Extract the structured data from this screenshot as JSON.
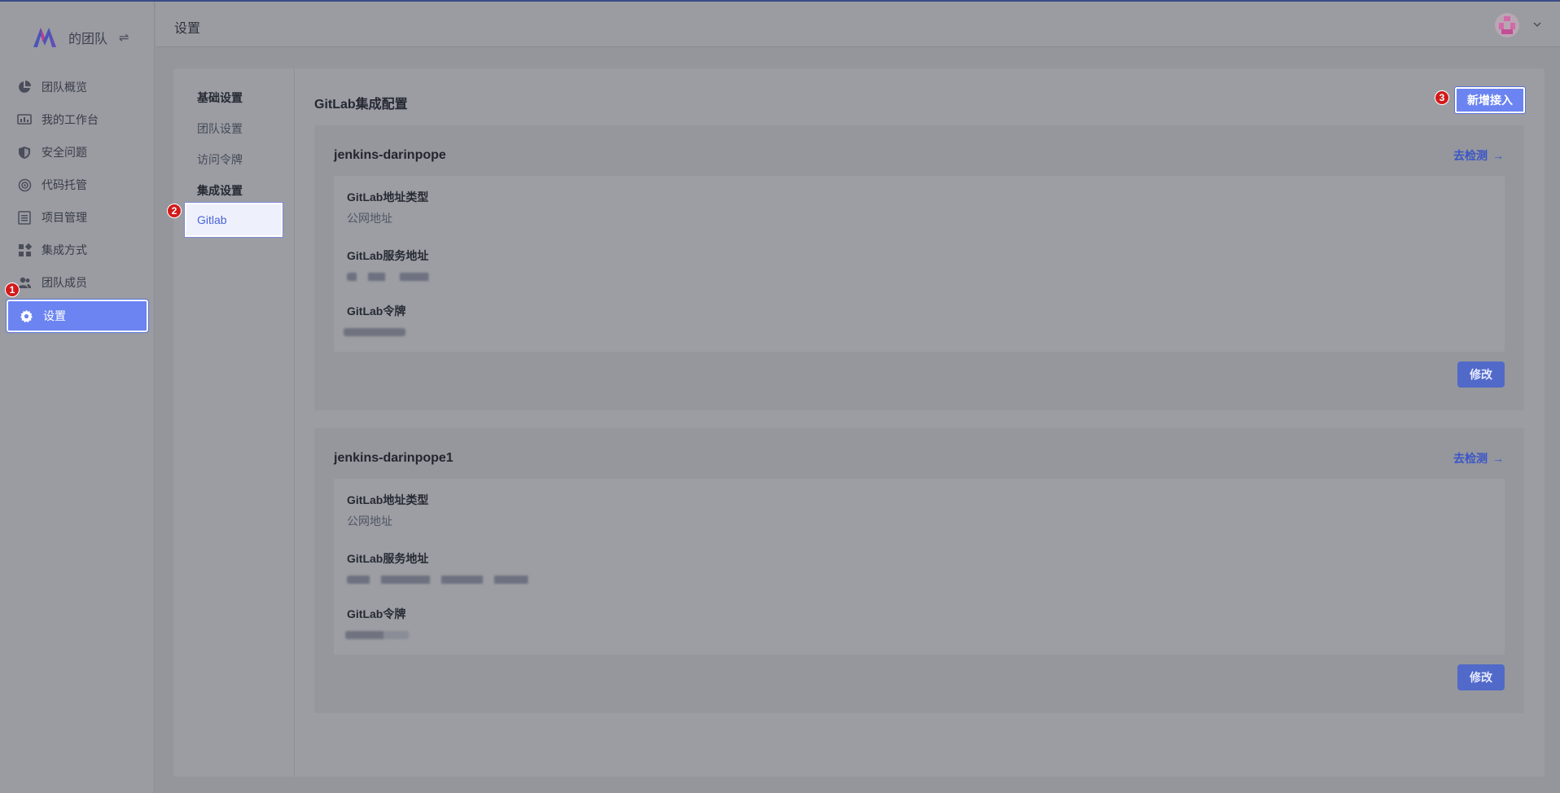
{
  "brand": {
    "name": "的团队",
    "switch_icon": "⇌"
  },
  "sidebar": {
    "items": [
      {
        "label": "团队概览",
        "icon": "pie-chart-icon"
      },
      {
        "label": "我的工作台",
        "icon": "dashboard-icon"
      },
      {
        "label": "安全问题",
        "icon": "shield-icon"
      },
      {
        "label": "代码托管",
        "icon": "code-hosting-icon"
      },
      {
        "label": "项目管理",
        "icon": "list-icon"
      },
      {
        "label": "集成方式",
        "icon": "grid-icon"
      },
      {
        "label": "团队成员",
        "icon": "users-icon"
      },
      {
        "label": "设置",
        "icon": "gear-icon",
        "active": true
      }
    ]
  },
  "header": {
    "title": "设置"
  },
  "markers": {
    "m1": "1",
    "m2": "2",
    "m3": "3"
  },
  "subnav": {
    "group_basic": "基础设置",
    "link_team": "团队设置",
    "link_token": "访问令牌",
    "group_integration": "集成设置",
    "active_item": "Gitlab"
  },
  "main": {
    "title": "GitLab集成配置",
    "add_button": "新增接入",
    "detect_label": "去检测",
    "detect_arrow": "→",
    "edit_label": "修改",
    "field_type_label": "GitLab地址类型",
    "field_url_label": "GitLab服务地址",
    "field_token_label": "GitLab令牌",
    "cards": [
      {
        "name": "jenkins-darinpope",
        "type_value": "公网地址"
      },
      {
        "name": "jenkins-darinpope1",
        "type_value": "公网地址"
      }
    ]
  },
  "colors": {
    "accent": "#6b84f1",
    "marker": "#d21a1a",
    "link": "#3a55c9"
  }
}
